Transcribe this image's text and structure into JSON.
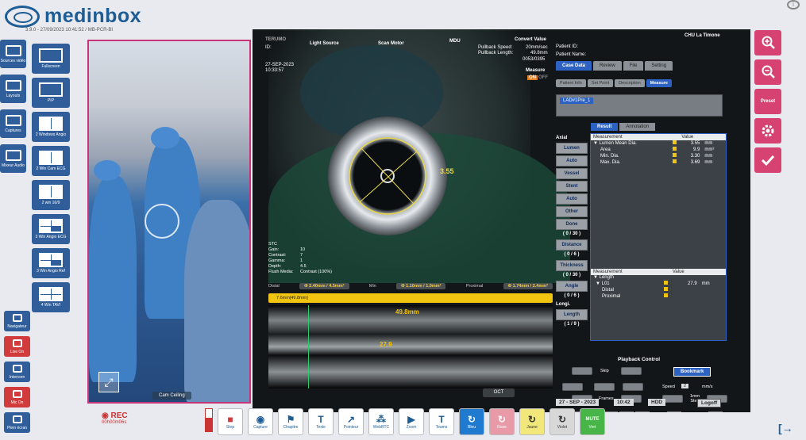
{
  "app": {
    "brand": "medinbox",
    "version": "3.9.0 - 27/09/2023 10:41:52 / MB-PCR-BI"
  },
  "left_tools": [
    {
      "label": "Sources vidéo",
      "icon": "camera-icon"
    },
    {
      "label": "Layouts",
      "icon": "grid-icon"
    },
    {
      "label": "Captures",
      "icon": "camera-capture-icon"
    },
    {
      "label": "Mixeur Audio",
      "icon": "audio-mixer-icon"
    }
  ],
  "layouts": [
    {
      "label": "Fullscreen"
    },
    {
      "label": "PIP"
    },
    {
      "label": "2 Windows Angio"
    },
    {
      "label": "2 Win Cam ECG"
    },
    {
      "label": "2 win 16/9"
    },
    {
      "label": "3 Win Angio ECG"
    },
    {
      "label": "3 Win Angio Ref"
    },
    {
      "label": "4 Win TAVI"
    }
  ],
  "bottom_left_tools": [
    {
      "label": "Navigateur"
    },
    {
      "label": "Live On"
    },
    {
      "label": "Intercom"
    },
    {
      "label": "Mic On"
    },
    {
      "label": "Plein écran"
    }
  ],
  "video": {
    "camera_label": "Cam Ceiling"
  },
  "ivus": {
    "brand": "TERUMO",
    "id_label": "ID:",
    "date": "27-SEP-2023",
    "time": "10:33:57",
    "light_source": "Light Source",
    "scan_motor": "Scan Motor",
    "mdu": "MDU",
    "convert_value": "Convert Value",
    "pullback_speed_label": "Pullback Speed:",
    "pullback_speed": "20mm/sec",
    "pullback_length_label": "Pullback Length:",
    "pullback_length": "49.8mm",
    "frame": "0053/0395",
    "measure_label": "Measure",
    "on_label": "ON",
    "off_label": "OFF",
    "patient_id_label": "Patient ID:",
    "patient_name_label": "Patient Name:",
    "hospital": "CHU La Timone",
    "diameter_label": "3.55",
    "stc": {
      "title": "STC",
      "gain_label": "Gain:",
      "gain": "10",
      "contrast_label": "Contrast:",
      "contrast": "7",
      "gamma_label": "Gamma:",
      "gamma": "1",
      "depth_label": "Depth:",
      "depth": "4.5",
      "flush_label": "Flush Media:",
      "flush": "Contrast (100%)"
    },
    "distal_label": "Distal",
    "distal_value": "Φ 2.40mm / 4.5mm²",
    "min_label": "Min",
    "min_value": "Φ 1.10mm / 1.0mm²",
    "proximal_label": "Proximal",
    "proximal_value": "Φ 1.74mm / 2.4mm²",
    "ruler_text": "7.6mm[49.8mm]",
    "l_length": "49.8mm",
    "l_value": "27.9",
    "oct_label": "OCT"
  },
  "panel": {
    "tabs": [
      "Case Data",
      "Review",
      "File",
      "Setting"
    ],
    "subtabs": [
      "Patient Info",
      "Set Point",
      "Description",
      "Measure"
    ],
    "frame_label": "LAD#1Pre_1",
    "result_tabs": [
      "Result",
      "Annotation"
    ],
    "axial_label": "Axial",
    "side_buttons": [
      {
        "label": "Lumen"
      },
      {
        "label": "Auto"
      },
      {
        "label": "Vessel"
      },
      {
        "label": "Stent"
      },
      {
        "label": "Auto"
      },
      {
        "label": "Other"
      },
      {
        "label": "Done"
      }
    ],
    "counts": {
      "c1": "( 0 / 30 )",
      "c2": "( 0 / 6 )",
      "c3": "( 0 / 30 )",
      "c4": "( 0 / 6 )",
      "c5": "( 1 / 9 )"
    },
    "distance_label": "Distance",
    "thickness_label": "Thickness",
    "angle_label": "Angle",
    "longi_label": "Longi.",
    "length_label": "Length",
    "table1_header": {
      "measurement": "Measurement",
      "value": "Value"
    },
    "table1": [
      {
        "name": "▼ Lumen Mean Dia.",
        "value": "3.55",
        "unit": "mm"
      },
      {
        "name": "Area",
        "value": "9.9",
        "unit": "mm²"
      },
      {
        "name": "Min. Dia.",
        "value": "3.30",
        "unit": "mm"
      },
      {
        "name": "Max. Dia.",
        "value": "3.69",
        "unit": "mm"
      }
    ],
    "table2_header": {
      "measurement": "Measurement",
      "value": "Value"
    },
    "table2": [
      {
        "name": "▼ Length",
        "value": "",
        "unit": ""
      },
      {
        "name": "▼ L01",
        "value": "27.9",
        "unit": "mm"
      },
      {
        "name": "Distal",
        "value": "",
        "unit": ""
      },
      {
        "name": "Proximal",
        "value": "",
        "unit": ""
      }
    ],
    "playback_title": "Playback Control",
    "skip_label": "Skip",
    "bookmark_label": "Bookmark",
    "speed_label": "Speed",
    "speed_value": "2",
    "speed_unit": "mm/s",
    "frames_label": "Frames",
    "step_label": "1mm Step",
    "view_3d": "3D",
    "date": "27 - SEP - 2023",
    "time": "10:42",
    "hdd_label": "HDD",
    "logoff_label": "Logoff"
  },
  "right_tools": [
    {
      "label": "",
      "icon": "zoom-in-icon"
    },
    {
      "label": "",
      "icon": "zoom-out-icon"
    },
    {
      "label": "Preset",
      "icon": "preset-icon"
    },
    {
      "label": "",
      "icon": "gear-icon"
    },
    {
      "label": "",
      "icon": "check-icon"
    }
  ],
  "recording": {
    "label": "REC",
    "time": "00h00m06s"
  },
  "toolbar": [
    {
      "label": "Stop",
      "glyph": "■",
      "style": ""
    },
    {
      "label": "Capture",
      "glyph": "◉",
      "style": ""
    },
    {
      "label": "Chapitre",
      "glyph": "⚑",
      "style": ""
    },
    {
      "label": "Texte",
      "glyph": "T",
      "style": ""
    },
    {
      "label": "Pointeur",
      "glyph": "↗",
      "style": ""
    },
    {
      "label": "WebRTC",
      "glyph": "⁂",
      "style": ""
    },
    {
      "label": "Zoom",
      "glyph": "▶",
      "style": ""
    },
    {
      "label": "Teams",
      "glyph": "T",
      "style": ""
    },
    {
      "label": "Bleu",
      "glyph": "↻",
      "style": "blue"
    },
    {
      "label": "Rose",
      "glyph": "↻",
      "style": "pink"
    },
    {
      "label": "Jaune",
      "glyph": "↻",
      "style": "yellow"
    },
    {
      "label": "Violet",
      "glyph": "↻",
      "style": "gray"
    },
    {
      "label": "Vert",
      "glyph": "MUTE",
      "style": "green"
    }
  ],
  "colors": {
    "brand_blue": "#1d5c94",
    "accent_pink": "#d64272",
    "panel_blue": "#2d62c2",
    "measure_yellow": "#f1c40f"
  }
}
